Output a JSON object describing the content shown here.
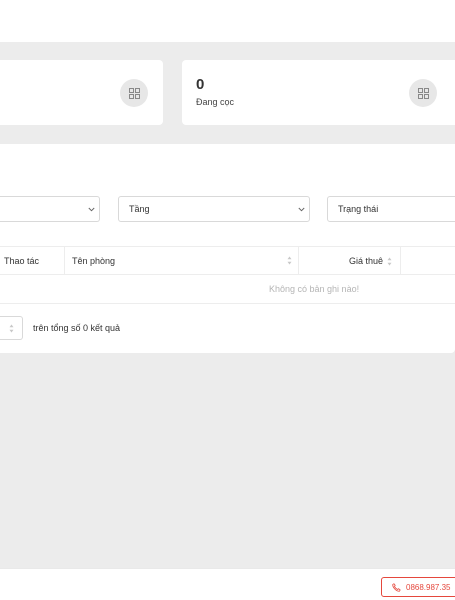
{
  "stats": [
    {
      "value": "",
      "label": "",
      "icon": "grid-icon"
    },
    {
      "value": "0",
      "label": "Đang cọc",
      "icon": "grid-icon"
    }
  ],
  "filters": {
    "first": "",
    "floor": "Tầng",
    "status": "Trạng thái"
  },
  "table": {
    "columns": [
      "Thao tác",
      "Tên phòng",
      "Giá thuê"
    ],
    "empty_text": "Không có bản ghi nào!"
  },
  "pagination": {
    "summary": "trên tổng số 0 kết quả"
  },
  "footer": {
    "phone": "0868.987.35",
    "accent_color": "#e5483d",
    "icon": "phone-icon"
  }
}
